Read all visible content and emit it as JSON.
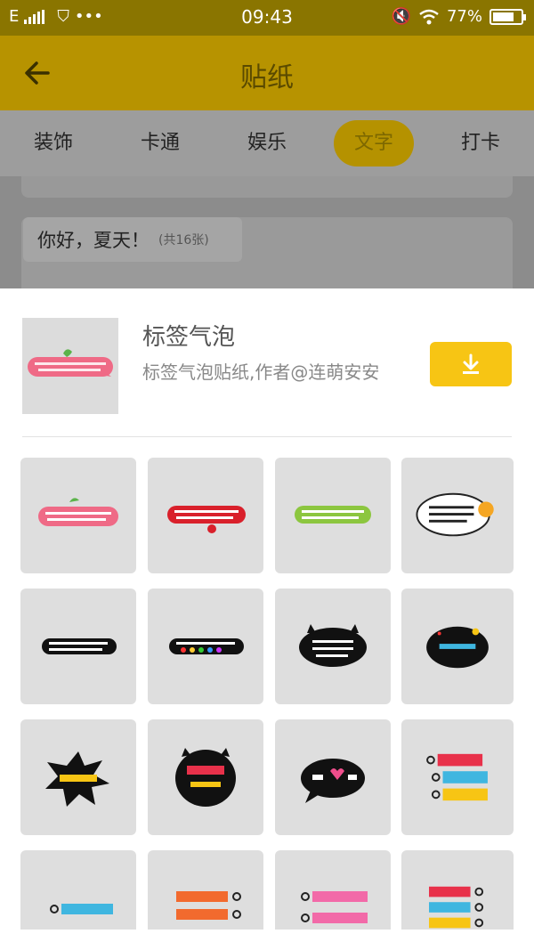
{
  "status_bar": {
    "carrier": "E",
    "time": "09:43",
    "battery": "77%",
    "battery_level": 0.77
  },
  "header": {
    "title": "贴纸"
  },
  "tabs": [
    {
      "label": "装饰"
    },
    {
      "label": "卡通"
    },
    {
      "label": "娱乐"
    },
    {
      "label": "文字",
      "active": true
    },
    {
      "label": "打卡"
    }
  ],
  "background_list": {
    "item_title": "你好，夏天！",
    "item_count": "(共16张)"
  },
  "sheet": {
    "pack_name": "标签气泡",
    "pack_desc": "标签气泡贴纸,作者@连萌安安",
    "download_icon": "download-icon"
  },
  "colors": {
    "accent": "#f7c514",
    "header": "#b79300",
    "status": "#8a7500"
  },
  "stickers": [
    {
      "name": "pink-bubble-sticker"
    },
    {
      "name": "red-bubble-sticker"
    },
    {
      "name": "green-bubble-sticker"
    },
    {
      "name": "cloud-cat-sticker"
    },
    {
      "name": "black-bar-sticker"
    },
    {
      "name": "black-rainbow-bar-sticker"
    },
    {
      "name": "black-cat-bubble-sticker"
    },
    {
      "name": "black-sparkle-bubble-sticker"
    },
    {
      "name": "burst-bubble-sticker"
    },
    {
      "name": "black-round-bubble-sticker"
    },
    {
      "name": "black-heart-bubble-sticker"
    },
    {
      "name": "tag-list-sticker"
    },
    {
      "name": "single-tag-sticker"
    },
    {
      "name": "orange-tags-sticker"
    },
    {
      "name": "pink-tags-sticker"
    },
    {
      "name": "stacked-tags-sticker"
    }
  ]
}
